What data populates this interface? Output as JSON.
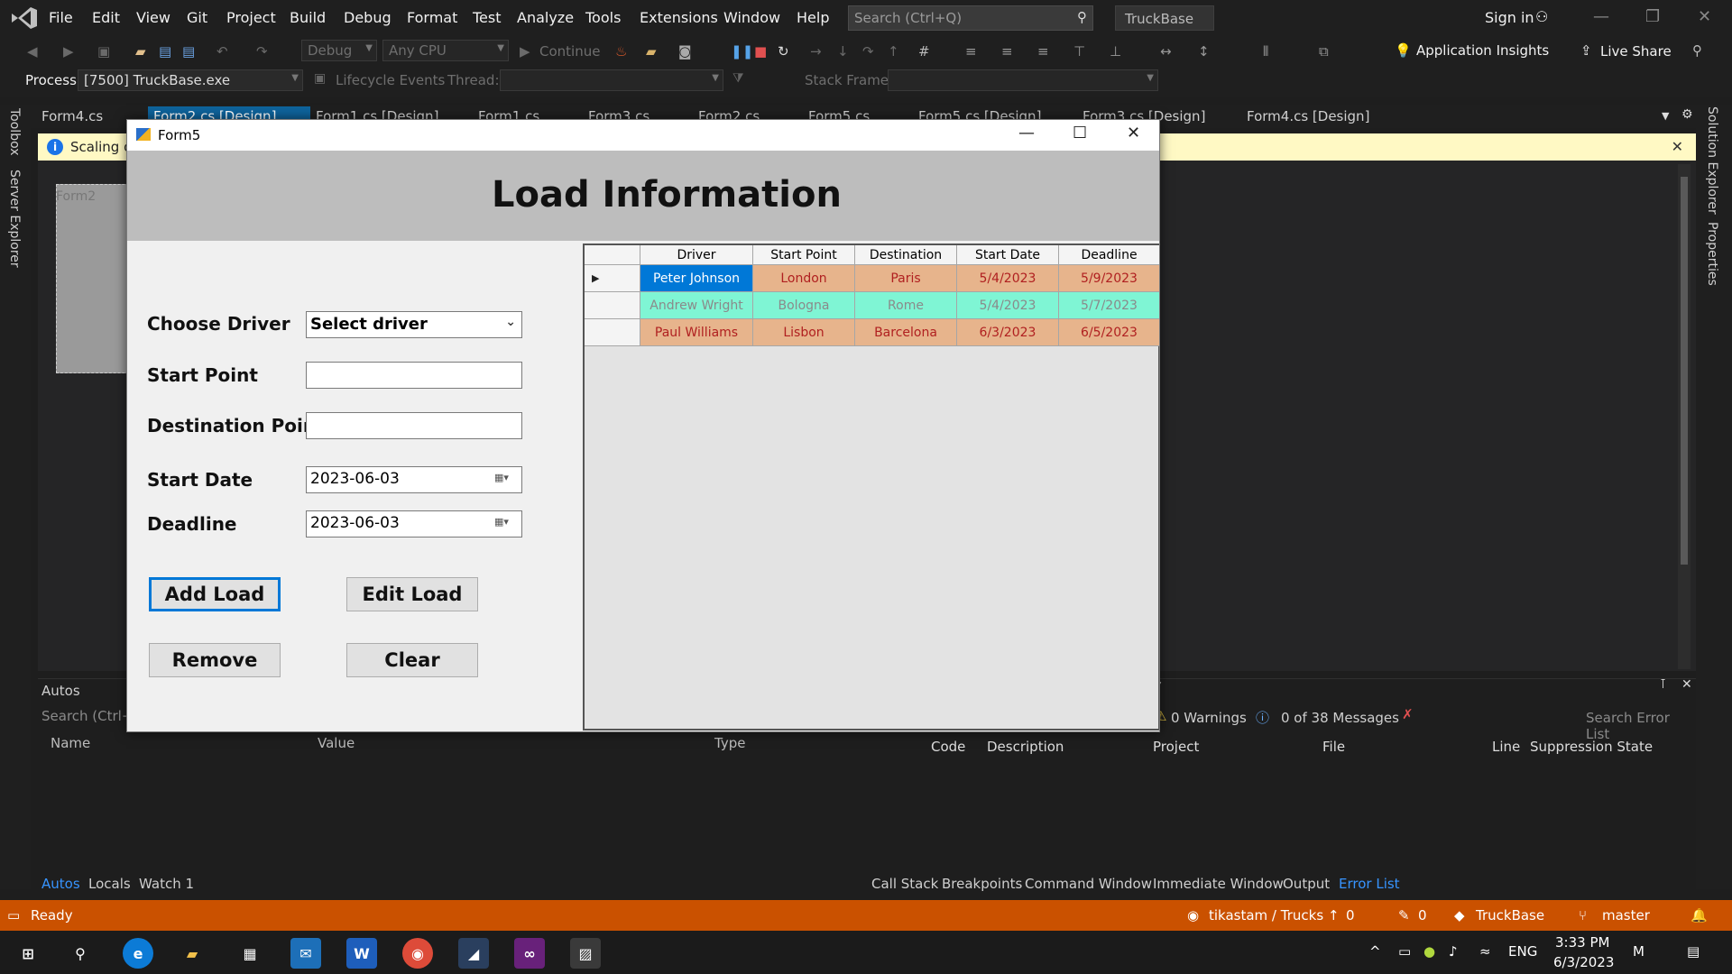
{
  "ide": {
    "menus": [
      "File",
      "Edit",
      "View",
      "Git",
      "Project",
      "Build",
      "Debug",
      "Format",
      "Test",
      "Analyze",
      "Tools",
      "Extensions",
      "Window",
      "Help"
    ],
    "search_placeholder": "Search (Ctrl+Q)",
    "solution_name": "TruckBase",
    "sign_in": "Sign in",
    "config_combo": "Debug",
    "platform_combo": "Any CPU",
    "continue_label": "Continue",
    "app_insights": "Application Insights",
    "live_share": "Live Share",
    "process_label": "Process:",
    "process_value": "[7500] TruckBase.exe",
    "lifecycle_label": "Lifecycle Events",
    "thread_label": "Thread:",
    "stack_frame_label": "Stack Frame:",
    "tabs": [
      "Form4.cs",
      "Form2.cs [Design]",
      "Form1.cs [Design]",
      "Form1.cs",
      "Form3.cs",
      "Form2.cs",
      "Form5.cs",
      "Form5.cs [Design]",
      "Form3.cs [Design]",
      "Form4.cs [Design]"
    ],
    "left_side_tabs": [
      "Toolbox",
      "Server Explorer"
    ],
    "right_side_tabs": [
      "Solution Explorer",
      "Properties"
    ],
    "infobar_text": "Scaling o",
    "ghost_form_title": "Form2",
    "autos": {
      "title": "Autos",
      "search_placeholder": "Search (Ctrl+E)",
      "col_name": "Name",
      "col_value": "Value",
      "col_type": "Type",
      "tabs": [
        "Autos",
        "Locals",
        "Watch 1"
      ]
    },
    "errors": {
      "warnings": "0 Warnings",
      "messages": "0 of 38 Messages",
      "search_placeholder": "Search Error List",
      "cols": [
        "Code",
        "Description",
        "Project",
        "File",
        "Line",
        "Suppression State"
      ],
      "tabs": [
        "Call Stack",
        "Breakpoints",
        "Command Window",
        "Immediate Window",
        "Output",
        "Error List"
      ]
    },
    "status": {
      "ready": "Ready",
      "repo": "tikastam / Trucks",
      "up_count": "0",
      "pen_count": "0",
      "project": "TruckBase",
      "branch": "master"
    }
  },
  "taskbar": {
    "lang": "ENG",
    "time": "3:33 PM",
    "date": "6/3/2023"
  },
  "form5": {
    "window_title": "Form5",
    "banner_title": "Load Information",
    "labels": {
      "driver": "Choose Driver",
      "start": "Start Point",
      "destination": "Destination Point",
      "start_date": "Start Date",
      "deadline": "Deadline"
    },
    "driver_value": "Select driver",
    "start_point_value": "",
    "destination_value": "",
    "start_date_value": "2023-06-03",
    "deadline_value": "2023-06-03",
    "buttons": {
      "add": "Add Load",
      "edit": "Edit Load",
      "remove": "Remove",
      "clear": "Clear"
    },
    "grid": {
      "headers": [
        "Driver",
        "Start Point",
        "Destination",
        "Start Date",
        "Deadline"
      ],
      "rows": [
        {
          "driver": "Peter Johnson",
          "start": "London",
          "dest": "Paris",
          "start_date": "5/4/2023",
          "deadline": "5/9/2023",
          "bg": "#e7b48c",
          "fg": "#b02020",
          "selected": true
        },
        {
          "driver": "Andrew Wright",
          "start": "Bologna",
          "dest": "Rome",
          "start_date": "5/4/2023",
          "deadline": "5/7/2023",
          "bg": "#7ff5d4",
          "fg": "#8a8a8a",
          "selected": false
        },
        {
          "driver": "Paul Williams",
          "start": "Lisbon",
          "dest": "Barcelona",
          "start_date": "6/3/2023",
          "deadline": "6/5/2023",
          "bg": "#e7b48c",
          "fg": "#b02020",
          "selected": false
        }
      ],
      "selected_cell_bg": "#0078d7"
    }
  }
}
